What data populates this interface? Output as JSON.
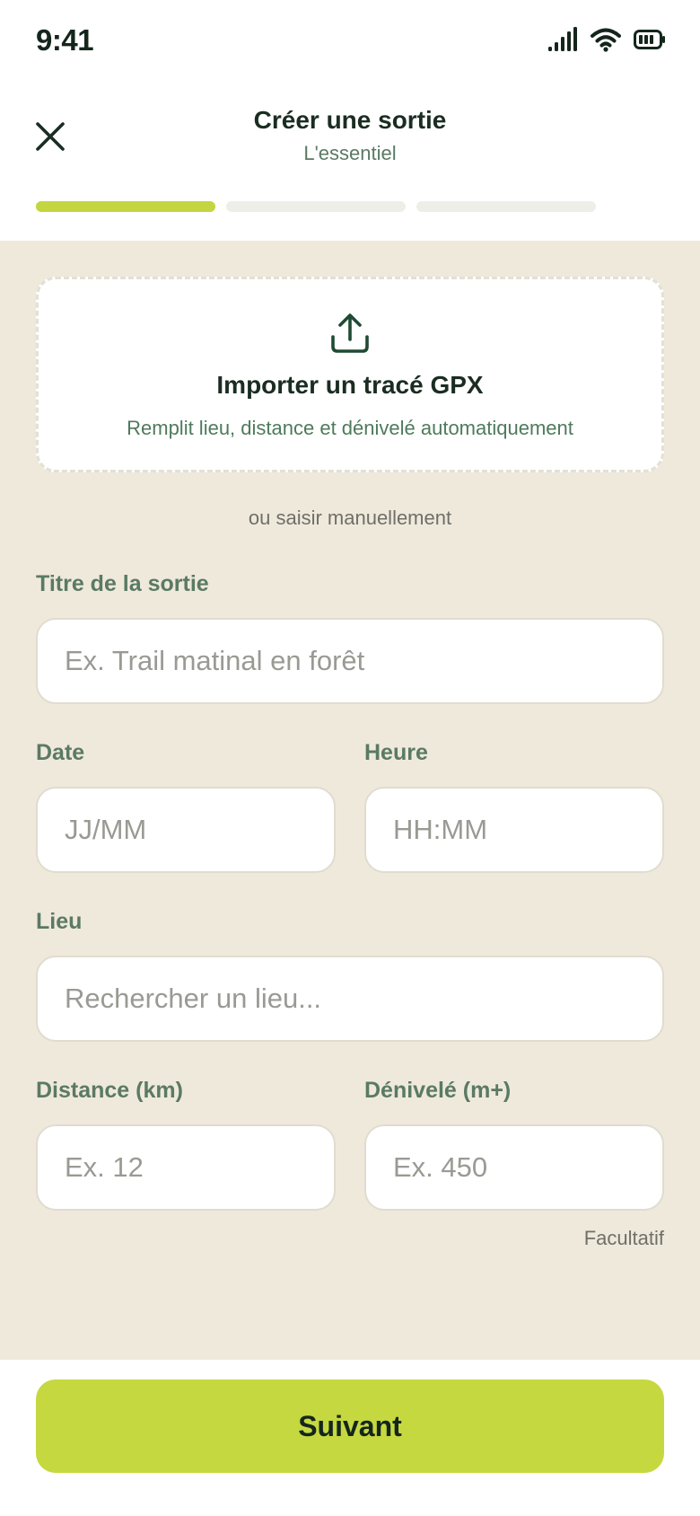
{
  "status_bar": {
    "time": "9:41"
  },
  "header": {
    "title": "Créer une sortie",
    "subtitle": "L'essentiel",
    "progress_step": 1,
    "progress_total": 3
  },
  "gpx_import": {
    "title": "Importer un tracé GPX",
    "subtitle": "Remplit lieu, distance et dénivelé automatiquement"
  },
  "divider_text": "ou saisir manuellement",
  "form": {
    "title_label": "Titre de la sortie",
    "title_placeholder": "Ex. Trail matinal en forêt",
    "date_label": "Date",
    "date_placeholder": "JJ/MM",
    "time_label": "Heure",
    "time_placeholder": "HH:MM",
    "place_label": "Lieu",
    "place_placeholder": "Rechercher un lieu...",
    "distance_label": "Distance (km)",
    "distance_placeholder": "Ex. 12",
    "elevation_label": "Dénivelé (m+)",
    "elevation_placeholder": "Ex. 450",
    "optional_note": "Facultatif"
  },
  "footer": {
    "next_label": "Suivant"
  },
  "colors": {
    "accent": "#c6d840",
    "background": "#efe9dc",
    "label_green": "#5a7a63"
  }
}
